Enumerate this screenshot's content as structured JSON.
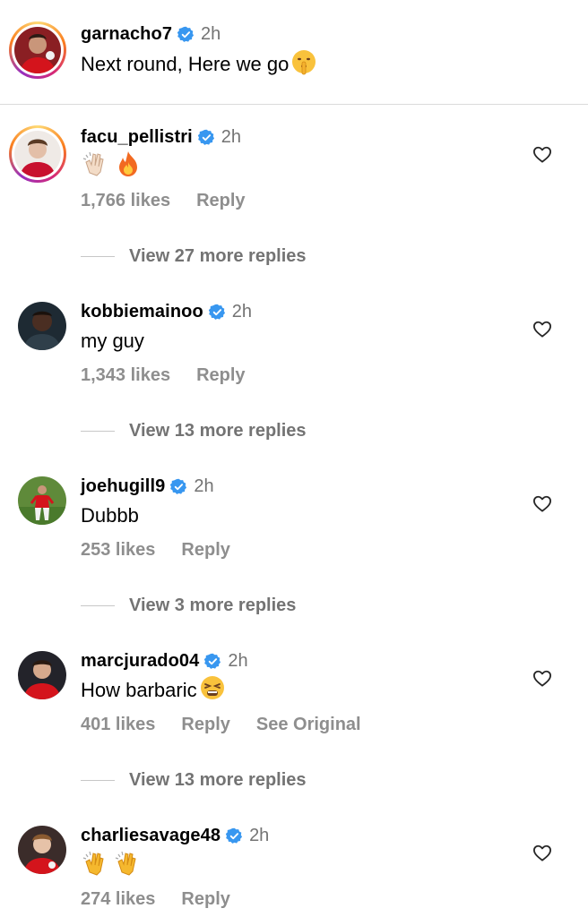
{
  "caption": {
    "username": "garnacho7",
    "time": "2h",
    "text": "Next round, Here we go"
  },
  "comments": [
    {
      "username": "facu_pellistri",
      "time": "2h",
      "text": "",
      "likes": "1,766 likes",
      "reply": "Reply",
      "view_replies": "View 27 more replies"
    },
    {
      "username": "kobbiemainoo",
      "time": "2h",
      "text": "my guy",
      "likes": "1,343 likes",
      "reply": "Reply",
      "view_replies": "View 13 more replies"
    },
    {
      "username": "joehugill9",
      "time": "2h",
      "text": "Dubbb",
      "likes": "253 likes",
      "reply": "Reply",
      "view_replies": "View 3 more replies"
    },
    {
      "username": "marcjurado04",
      "time": "2h",
      "text": "How barbaric",
      "likes": "401 likes",
      "reply": "Reply",
      "see_original": "See Original",
      "view_replies": "View 13 more replies"
    },
    {
      "username": "charliesavage48",
      "time": "2h",
      "text": "",
      "likes": "274 likes",
      "reply": "Reply"
    }
  ],
  "colors": {
    "verified": "#3897f0",
    "muted": "#8e8e8e",
    "divider": "#dbdbdb"
  },
  "icons": [
    "verified-badge-icon",
    "heart-outline-icon",
    "shushing-face-emoji",
    "clapping-hands-emoji",
    "fire-emoji",
    "tired-face-emoji"
  ]
}
